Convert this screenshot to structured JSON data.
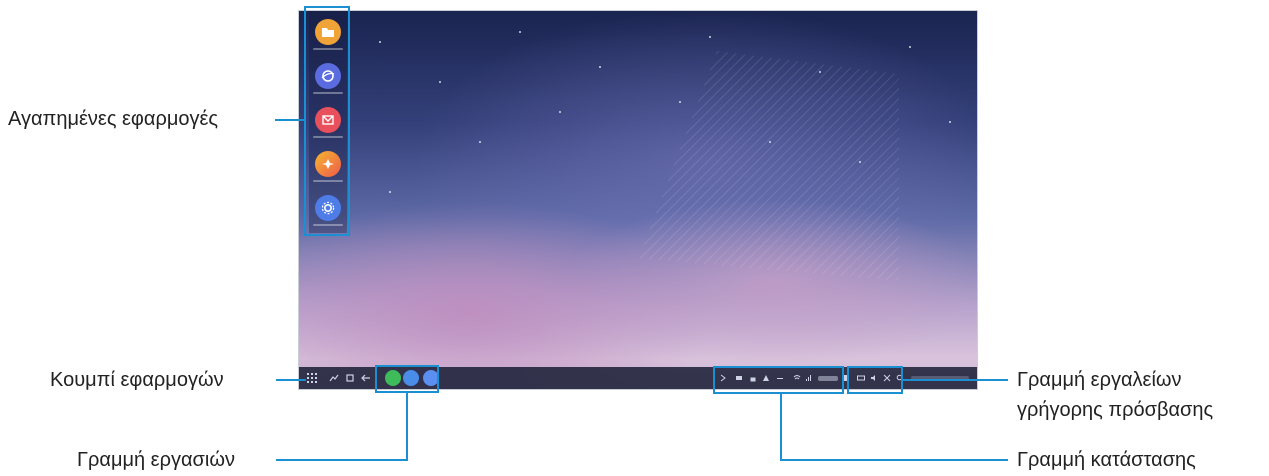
{
  "labels": {
    "favorite_apps": "Αγαπημένες εφαρμογές",
    "apps_button": "Κουμπί εφαρμογών",
    "taskbar": "Γραμμή εργασιών",
    "quick_access_toolbar_line1": "Γραμμή εργαλείων",
    "quick_access_toolbar_line2": "γρήγορης πρόσβασης",
    "status_bar": "Γραμμή κατάστασης"
  },
  "favorite_apps": [
    {
      "name": "my-files-icon",
      "color": "#f0a336"
    },
    {
      "name": "internet-icon",
      "color": "#5b6ce0"
    },
    {
      "name": "email-icon",
      "color": "#e8505b"
    },
    {
      "name": "gallery-icon",
      "color": "#f07a3a"
    },
    {
      "name": "settings-icon",
      "color": "#4f7de8"
    }
  ],
  "taskbar_apps": [
    {
      "name": "phone-app-icon",
      "color": "#3ebc5a"
    },
    {
      "name": "internet-app-icon",
      "color": "#4a8de8"
    },
    {
      "name": "settings-app-icon",
      "color": "#5a8ef0"
    }
  ],
  "colors": {
    "highlight": "#1a8fd1",
    "taskbar": "#181c34"
  }
}
